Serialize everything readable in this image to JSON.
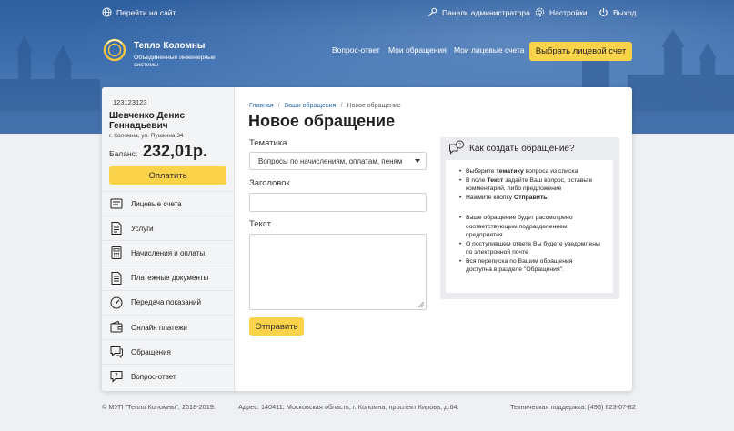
{
  "topbar": {
    "goto_site": "Перейти на сайт",
    "admin_panel": "Панель администратора",
    "settings": "Настройки",
    "logout": "Выход"
  },
  "logo": {
    "name": "Тепло Коломны",
    "subtitle": "Объединенные инженерные системы"
  },
  "nav": {
    "items": [
      "Вопрос-ответ",
      "Мои обращения",
      "Мои лицевые счета"
    ],
    "select_account": "Выбрать лицевой счет"
  },
  "account": {
    "number": "123123123",
    "name": "Шевченко Денис Геннадьевич",
    "address": "г. Коломна, ул. Пушкина 34",
    "balance_label": "Баланс:",
    "balance_value": "232,01р.",
    "pay_button": "Оплатить"
  },
  "menu": [
    {
      "label": "Лицевые счета",
      "icon": "accounts-icon"
    },
    {
      "label": "Услуги",
      "icon": "document-icon"
    },
    {
      "label": "Начисления и оплаты",
      "icon": "calculator-icon"
    },
    {
      "label": "Платежные документы",
      "icon": "payment-docs-icon"
    },
    {
      "label": "Передача показаний",
      "icon": "meter-icon"
    },
    {
      "label": "Онлайн платежи",
      "icon": "wallet-icon"
    },
    {
      "label": "Обращения",
      "icon": "chat-icon"
    },
    {
      "label": "Вопрос-ответ",
      "icon": "faq-icon"
    }
  ],
  "breadcrumbs": {
    "home": "Главная",
    "requests": "Ваши обращения",
    "current": "Новое обращение"
  },
  "form": {
    "title": "Новое обращение",
    "topic_label": "Тематика",
    "topic_value": "Вопросы по начислениям, оплатам, пеням",
    "subject_label": "Заголовок",
    "subject_value": "",
    "text_label": "Текст",
    "text_value": "",
    "submit": "Отправить"
  },
  "help": {
    "title": "Как создать обращение?",
    "steps": {
      "s1_pre": "Выберите ",
      "s1_bold": "тематику",
      "s1_post": " вопроса из списка",
      "s2_pre": "В поле ",
      "s2_bold": "Текст",
      "s2_post": " задайте Ваш вопрос, оставьте комментарий, либо предложение",
      "s3_pre": "Нажмите кнопку ",
      "s3_bold": "Отправить"
    },
    "notes": [
      "Ваше обращение будет рассмотрено соответствующим подразделением предприятия",
      "О поступившем ответе Вы будете уведомлены по электронной почте",
      "Вся переписка по Вашим обращения доступна в разделе \"Обращения\"."
    ]
  },
  "footer": {
    "copyright": "© МУП \"Тепло Коломны\", 2018-2019.",
    "address": "Адрес: 140411, Московская область, г. Коломна, проспект Кирова, д.64.",
    "support": "Техническая поддержка: (496) 623-07-82"
  },
  "colors": {
    "accent": "#fbd34a",
    "header_blue": "#3d6fae",
    "link": "#2a6bb0"
  }
}
